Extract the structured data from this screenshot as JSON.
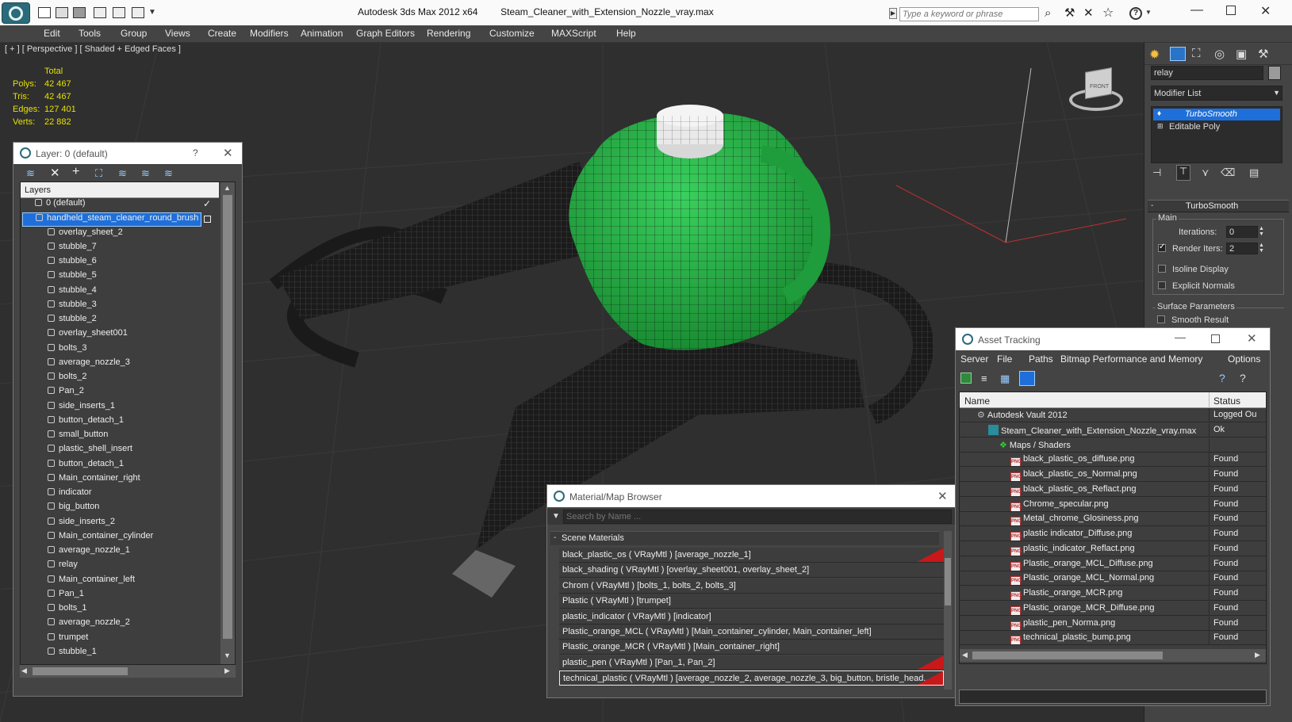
{
  "app": {
    "title": "Autodesk 3ds Max  2012 x64",
    "filename": "Steam_Cleaner_with_Extension_Nozzle_vray.max",
    "search_placeholder": "Type a keyword or phrase"
  },
  "menu": [
    "Edit",
    "Tools",
    "Group",
    "Views",
    "Create",
    "Modifiers",
    "Animation",
    "Graph Editors",
    "Rendering",
    "Customize",
    "MAXScript",
    "Help"
  ],
  "viewport": {
    "label": "[ + ] [ Perspective ] [ Shaded + Edged Faces ]",
    "stats": {
      "header": "Total",
      "rows": [
        {
          "label": "Polys:",
          "value": "42 467"
        },
        {
          "label": "Tris:",
          "value": "42 467"
        },
        {
          "label": "Edges:",
          "value": "127 401"
        },
        {
          "label": "Verts:",
          "value": "22 882"
        }
      ]
    },
    "viewcube_label": "FRONT"
  },
  "layer_window": {
    "title": "Layer: 0 (default)",
    "help": "?",
    "header": "Layers",
    "items": [
      "0 (default)",
      "handheld_steam_cleaner_round_brush",
      "overlay_sheet_2",
      "stubble_7",
      "stubble_6",
      "stubble_5",
      "stubble_4",
      "stubble_3",
      "stubble_2",
      "overlay_sheet001",
      "bolts_3",
      "average_nozzle_3",
      "bolts_2",
      "Pan_2",
      "side_inserts_1",
      "button_detach_1",
      "small_button",
      "plastic_shell_insert",
      "button_detach_1",
      "Main_container_right",
      "indicator",
      "big_button",
      "side_inserts_2",
      "Main_container_cylinder",
      "average_nozzle_1",
      "relay",
      "Main_container_left",
      "Pan_1",
      "bolts_1",
      "average_nozzle_2",
      "trumpet",
      "stubble_1"
    ]
  },
  "command_panel": {
    "object_name": "relay",
    "modifier_list": "Modifier List",
    "stack": [
      "TurboSmooth",
      "Editable Poly"
    ],
    "rollout_title": "TurboSmooth",
    "main_group": "Main",
    "iterations_label": "Iterations:",
    "iterations_value": "0",
    "render_iters_label": "Render Iters:",
    "render_iters_value": "2",
    "isoline": "Isoline Display",
    "explicit_normals": "Explicit Normals",
    "surface_params": "Surface Parameters",
    "smooth_result": "Smooth Result"
  },
  "asset_tracking": {
    "title": "Asset Tracking",
    "menu": [
      "Server",
      "File",
      "Paths",
      "Bitmap Performance and Memory",
      "Options"
    ],
    "col_name": "Name",
    "col_status": "Status",
    "rows": [
      {
        "name": "Autodesk Vault 2012",
        "status": "Logged Ou",
        "level": 0,
        "kind": "vault"
      },
      {
        "name": "Steam_Cleaner_with_Extension_Nozzle_vray.max",
        "status": "Ok",
        "level": 1,
        "kind": "max"
      },
      {
        "name": "Maps / Shaders",
        "status": "",
        "level": 2,
        "kind": "folder"
      },
      {
        "name": "black_plastic_os_diffuse.png",
        "status": "Found",
        "level": 3,
        "kind": "png"
      },
      {
        "name": "black_plastic_os_Normal.png",
        "status": "Found",
        "level": 3,
        "kind": "png"
      },
      {
        "name": "black_plastic_os_Reflact.png",
        "status": "Found",
        "level": 3,
        "kind": "png"
      },
      {
        "name": "Chrome_specular.png",
        "status": "Found",
        "level": 3,
        "kind": "png"
      },
      {
        "name": "Metal_chrome_Glosiness.png",
        "status": "Found",
        "level": 3,
        "kind": "png"
      },
      {
        "name": "plastic indicator_Diffuse.png",
        "status": "Found",
        "level": 3,
        "kind": "png"
      },
      {
        "name": "plastic_indicator_Reflact.png",
        "status": "Found",
        "level": 3,
        "kind": "png"
      },
      {
        "name": "Plastic_orange_MCL_Diffuse.png",
        "status": "Found",
        "level": 3,
        "kind": "png"
      },
      {
        "name": "Plastic_orange_MCL_Normal.png",
        "status": "Found",
        "level": 3,
        "kind": "png"
      },
      {
        "name": "Plastic_orange_MCR.png",
        "status": "Found",
        "level": 3,
        "kind": "png"
      },
      {
        "name": "Plastic_orange_MCR_Diffuse.png",
        "status": "Found",
        "level": 3,
        "kind": "png"
      },
      {
        "name": "plastic_pen_Norma.png",
        "status": "Found",
        "level": 3,
        "kind": "png"
      },
      {
        "name": "technical_plastic_bump.png",
        "status": "Found",
        "level": 3,
        "kind": "png"
      }
    ]
  },
  "material_browser": {
    "title": "Material/Map Browser",
    "search_placeholder": "Search by Name ...",
    "section": "Scene Materials",
    "materials": [
      "black_plastic_os  ( VRayMtl ) [average_nozzle_1]",
      "black_shading  ( VRayMtl ) [overlay_sheet001, overlay_sheet_2]",
      "Chrom  ( VRayMtl ) [bolts_1, bolts_2, bolts_3]",
      "Plastic  ( VRayMtl ) [trumpet]",
      "plastic_indicator  ( VRayMtl ) [indicator]",
      "Plastic_orange_MCL  ( VRayMtl ) [Main_container_cylinder, Main_container_left]",
      "Plastic_orange_MCR  ( VRayMtl ) [Main_container_right]",
      "plastic_pen  ( VRayMtl ) [Pan_1, Pan_2]",
      "technical_plastic  ( VRayMtl ) [average_nozzle_2, average_nozzle_3, big_button, bristle_head..."
    ],
    "flagged": [
      0,
      7,
      8
    ]
  },
  "colors": {
    "selection": "#1e6fd9",
    "green": "#1f9c3c",
    "accent": "#c8181a"
  }
}
